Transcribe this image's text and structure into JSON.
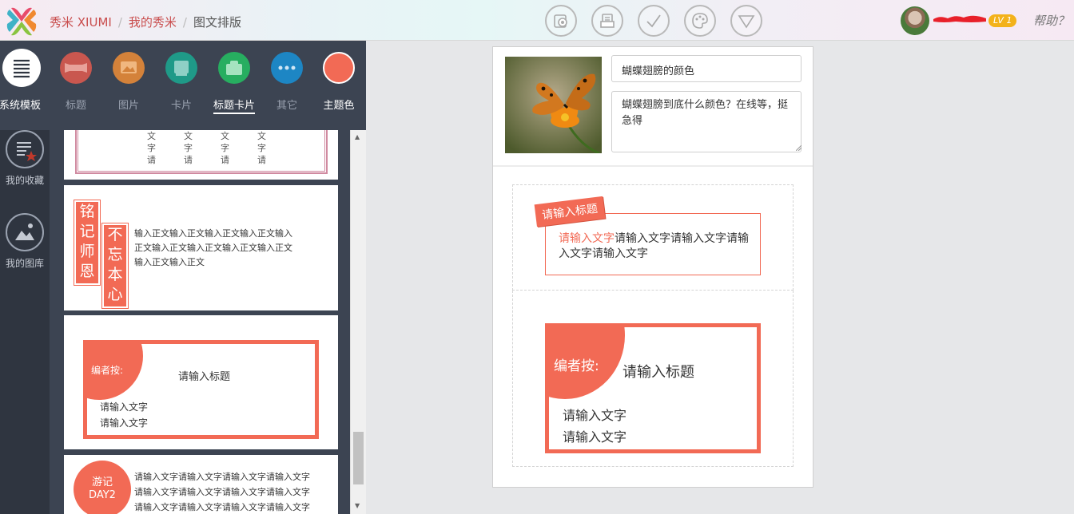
{
  "header": {
    "breadcrumb": [
      "秀米 XIUMI",
      "我的秀米",
      "图文排版"
    ],
    "tools": [
      "preview-icon",
      "save-icon",
      "check-icon",
      "palette-icon",
      "dropdown-icon"
    ],
    "user_level": "LV 1",
    "help": "帮助？"
  },
  "categories": [
    {
      "label": "系统模板",
      "icon": "list-icon",
      "color": "#ffffff",
      "active": true
    },
    {
      "label": "标题",
      "icon": "title-icon",
      "color": "#c9574f"
    },
    {
      "label": "图片",
      "icon": "image-icon",
      "color": "#d4823a"
    },
    {
      "label": "卡片",
      "icon": "card-icon",
      "color": "#1f9a88"
    },
    {
      "label": "标题卡片",
      "icon": "title-card-icon",
      "color": "#27ae60",
      "selected": true
    },
    {
      "label": "其它",
      "icon": "more-icon",
      "color": "#1d86c4"
    },
    {
      "label": "主题色",
      "icon": "theme-color-icon",
      "color": "#f26a55"
    }
  ],
  "side_nav": [
    {
      "label": "我的收藏",
      "icon": "favorites-icon"
    },
    {
      "label": "我的图库",
      "icon": "gallery-icon"
    }
  ],
  "templates": {
    "t1_chars": [
      "文",
      "字",
      "请"
    ],
    "t2_title_a": [
      "铭",
      "记",
      "师",
      "恩"
    ],
    "t2_title_b": [
      "不",
      "忘",
      "本",
      "心"
    ],
    "t2_body": "输入正文输入正文输入正文输入正文输入正文输入正文输入正文输入正文输入正文输入正文输入正文",
    "t3_tag": "编者按:",
    "t3_title": "请输入标题",
    "t3_line1": "请输入文字",
    "t3_line2": "请输入文字",
    "t4_badge": "游记\nDAY2",
    "t4_lines": [
      "请输入文字请输入文字请输入文字请输入文字",
      "请输入文字请输入文字请输入文字请输入文字",
      "请输入文字请输入文字请输入文字请输入文字"
    ]
  },
  "document": {
    "title": "蝴蝶翅膀的颜色",
    "description": "蝴蝶翅膀到底什么颜色？在线等，挺急得",
    "block1_tag": "请输入标题",
    "block1_highlight": "请输入文字",
    "block1_text": "请输入文字请输入文字请输入文字请输入文字",
    "block2_tag": "编者按:",
    "block2_title": "请输入标题",
    "block2_line1": "请输入文字",
    "block2_line2": "请输入文字"
  },
  "colors": {
    "accent": "#f26a55",
    "brand": "#c94e4e",
    "panel": "#3c4452"
  }
}
